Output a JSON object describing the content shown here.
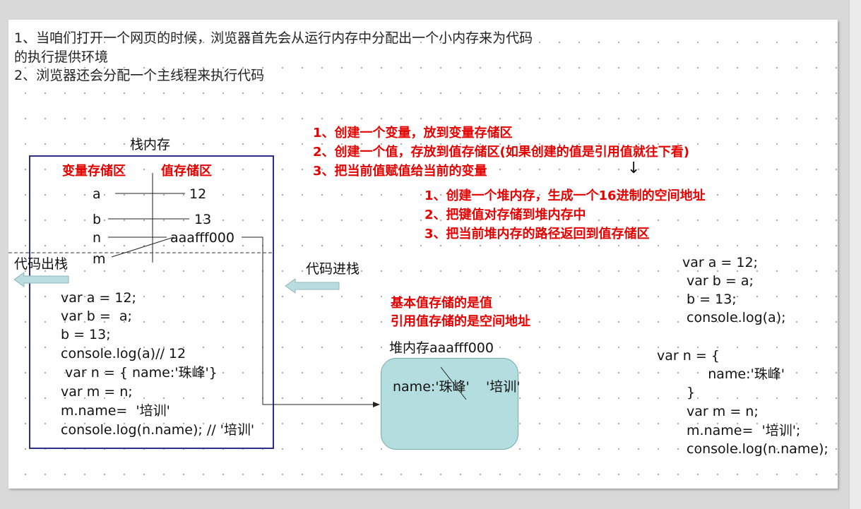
{
  "intro": {
    "line1": "1、当咱们打开一个网页的时候，浏览器首先会从运行内存中分配出一个小内存来为代码",
    "line2": "的执行提供环境",
    "line3": "2、浏览器还会分配一个主线程来执行代码"
  },
  "stack": {
    "title": "栈内存",
    "var_area_label": "变量存储区",
    "value_area_label": "值存储区",
    "vars": [
      {
        "name": "a",
        "value": "12"
      },
      {
        "name": "b",
        "value": "13"
      },
      {
        "name": "n",
        "value": "aaafff000"
      },
      {
        "name": "m",
        "value": ""
      }
    ],
    "pop_label": "代码出栈",
    "push_label": "代码进栈",
    "code": [
      "var a = 12;",
      "var b =  a;",
      "b = 13;",
      "console.log(a)// 12",
      " var n = { name:'珠峰'}",
      "var m = n;",
      "m.name=  '培训'",
      "console.log(n.name); // '培训'"
    ]
  },
  "steps_main": [
    "1、创建一个变量，放到变量存储区",
    "2、创建一个值，存放到值存储区(如果创建的值是引用值就往下看)",
    "3、把当前值赋值给当前的变量"
  ],
  "down_arrow": "↓",
  "steps_heap": [
    "1、创建一个堆内存，生成一个16进制的空间地址",
    "2、把键值对存储到堆内存中",
    "3、把当前堆内存的路径返回到值存储区"
  ],
  "note": {
    "line1": "基本值存储的是值",
    "line2": "引用值存储的是空间地址"
  },
  "heap": {
    "title": "堆内存aaafff000",
    "content_key": "name:'珠峰'",
    "content_new": "'培训'"
  },
  "right_code": [
    "var a = 12;",
    " var b = a;",
    " b = 13;",
    " console.log(a);",
    "",
    "var n = {",
    "      name:'珠峰'",
    " }",
    " var m = n;",
    " m.name=  '培训';",
    " console.log(n.name);"
  ],
  "colors": {
    "accent_red": "#e60000",
    "stack_border": "#2b2f8a",
    "heap_fill": "#b4dde0",
    "arrow_fill": "#b8dce0"
  }
}
